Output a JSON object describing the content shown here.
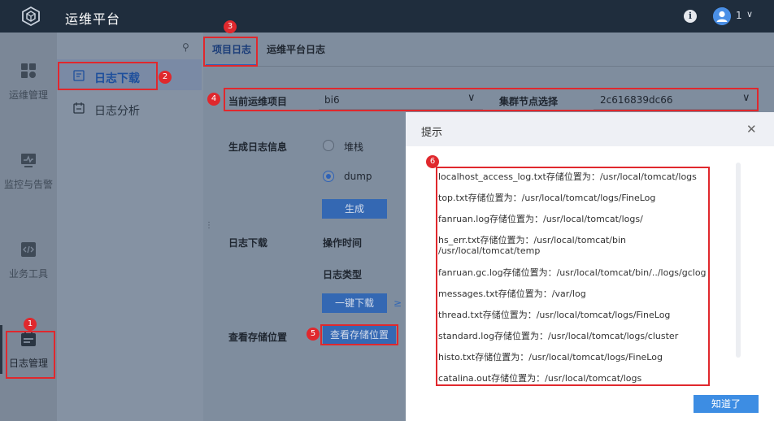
{
  "app": {
    "title": "运维平台"
  },
  "header": {
    "user_num": "1"
  },
  "left_nav": {
    "items": [
      {
        "label": "运维管理",
        "icon": "grid-icon"
      },
      {
        "label": "监控与告警",
        "icon": "monitor-icon"
      },
      {
        "label": "业务工具",
        "icon": "code-icon"
      },
      {
        "label": "日志管理",
        "icon": "calendar-icon"
      }
    ]
  },
  "sub_nav": {
    "items": [
      {
        "label": "日志下载",
        "icon": "download-icon",
        "active": true
      },
      {
        "label": "日志分析",
        "icon": "analysis-icon"
      }
    ]
  },
  "tabs": [
    {
      "label": "项目日志",
      "active": true
    },
    {
      "label": "运维平台日志"
    }
  ],
  "form": {
    "project_label": "当前运维项目",
    "project_value": "bi6",
    "node_label": "集群节点选择",
    "node_value": "2c616839dc66",
    "gen_label": "生成日志信息",
    "radio_stack": "堆栈",
    "radio_dump": "dump",
    "gen_button": "生成",
    "download_label": "日志下载",
    "op_time_label": "操作时间",
    "log_type_label": "日志类型",
    "one_click_button": "一键下载",
    "storage_label": "查看存储位置",
    "storage_button": "查看存储位置"
  },
  "dialog": {
    "title": "提示",
    "ok_button": "知道了",
    "paths": [
      "localhost_access_log.txt存储位置为：/usr/local/tomcat/logs",
      "top.txt存储位置为：/usr/local/tomcat/logs/FineLog",
      "fanruan.log存储位置为：/usr/local/tomcat/logs/",
      "hs_err.txt存储位置为：/usr/local/tomcat/bin",
      "/usr/local/tomcat/temp",
      "fanruan.gc.log存储位置为：/usr/local/tomcat/bin/../logs/gclogs/",
      "messages.txt存储位置为：/var/log",
      "thread.txt存储位置为：/usr/local/tomcat/logs/FineLog",
      "standard.log存储位置为：/usr/local/tomcat/logs/cluster",
      "histo.txt存储位置为：/usr/local/tomcat/logs/FineLog",
      "catalina.out存储位置为：/usr/local/tomcat/logs"
    ]
  },
  "badges": [
    "1",
    "2",
    "3",
    "4",
    "5",
    "6"
  ],
  "colors": {
    "highlight": "#e0282d",
    "primary": "#3468b3",
    "header": "#1f2d3d"
  }
}
